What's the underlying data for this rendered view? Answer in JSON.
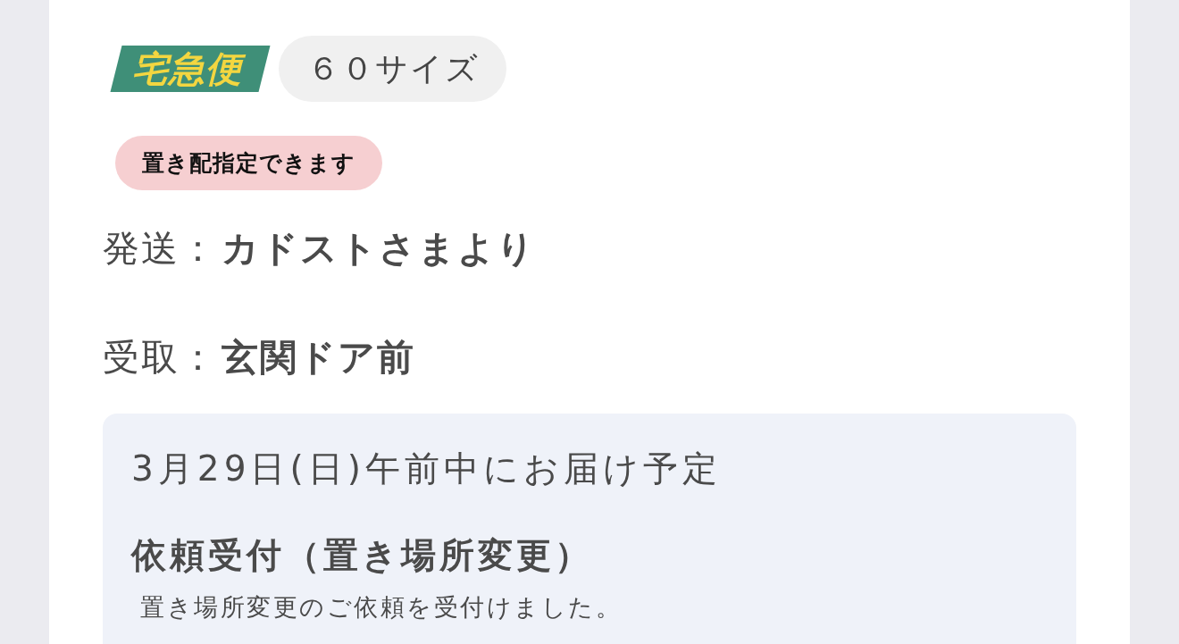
{
  "service": {
    "logo_text": "宅急便",
    "size": "６０サイズ"
  },
  "badge": "置き配指定できます",
  "details": [
    {
      "label": "発送：",
      "value": "カドストさまより"
    },
    {
      "label": "受取：",
      "value": "玄関ドア前"
    }
  ],
  "status_panel": {
    "delivery_date": "3月29日(日)午前中にお届け予定",
    "status_title": "依頼受付（置き場所変更）",
    "status_message": "置き場所変更のご依頼を受付けました。"
  }
}
